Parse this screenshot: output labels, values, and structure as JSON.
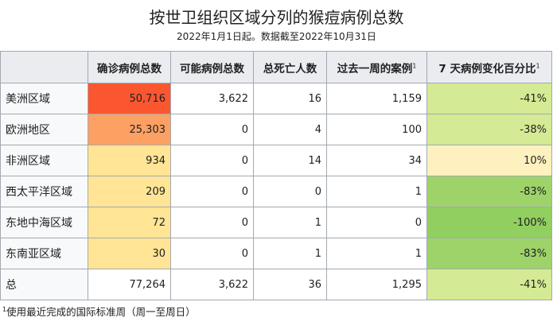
{
  "title": "按世卫组织区域分列的猴痘病例总数",
  "subtitle": "2022年1月1日起。数据截至2022年10月31日",
  "headers": [
    "确诊病例总数",
    "可能病例总数",
    "总死亡人数",
    "过去一周的案例",
    "7 天病例变化百分比"
  ],
  "footnote_mark": "1",
  "rows": [
    {
      "region": "美洲区域",
      "confirmed": "50,716",
      "probable": "3,622",
      "deaths": "16",
      "week": "1,159",
      "change": "-41%",
      "confirmed_color": "#fa5731",
      "change_color": "#d5ea94"
    },
    {
      "region": "欧洲地区",
      "confirmed": "25,303",
      "probable": "0",
      "deaths": "4",
      "week": "100",
      "change": "-38%",
      "confirmed_color": "#fda063",
      "change_color": "#d5ea94"
    },
    {
      "region": "非洲区域",
      "confirmed": "934",
      "probable": "0",
      "deaths": "14",
      "week": "34",
      "change": "10%",
      "confirmed_color": "#ffe595",
      "change_color": "#fff1bf"
    },
    {
      "region": "西太平洋区域",
      "confirmed": "209",
      "probable": "0",
      "deaths": "0",
      "week": "1",
      "change": "-83%",
      "confirmed_color": "#ffe595",
      "change_color": "#9ed36a"
    },
    {
      "region": "东地中海区域",
      "confirmed": "72",
      "probable": "0",
      "deaths": "1",
      "week": "0",
      "change": "-100%",
      "confirmed_color": "#ffe595",
      "change_color": "#91cf60"
    },
    {
      "region": "东南亚区域",
      "confirmed": "30",
      "probable": "0",
      "deaths": "1",
      "week": "1",
      "change": "-83%",
      "confirmed_color": "#ffe595",
      "change_color": "#9ed36a"
    }
  ],
  "total": {
    "label": "总",
    "confirmed": "77,264",
    "probable": "3,622",
    "deaths": "36",
    "week": "1,295",
    "change": "-41%",
    "change_color": "#d5ea94"
  },
  "footnote": "使用最近完成的国际标准周（周一至周日）"
}
